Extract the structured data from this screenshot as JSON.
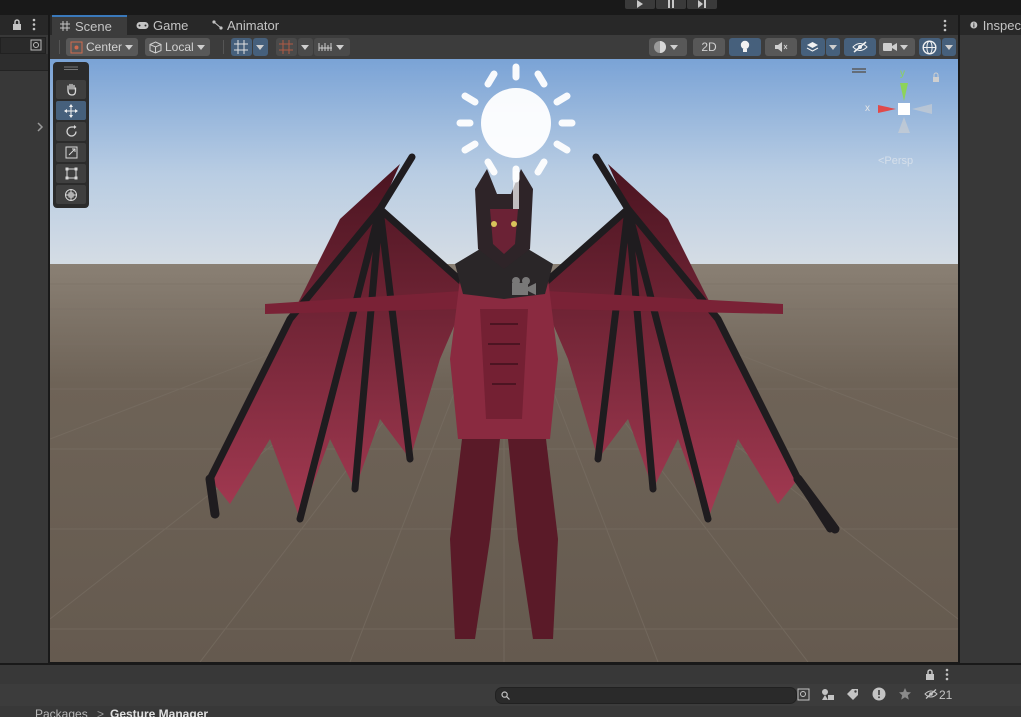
{
  "tabs": [
    {
      "label": "Scene",
      "icon": "grid-icon",
      "active": true
    },
    {
      "label": "Game",
      "icon": "gamepad-icon",
      "active": false
    },
    {
      "label": "Animator",
      "icon": "animator-icon",
      "active": false
    }
  ],
  "inspector_tab": "Inspec",
  "toolbar": {
    "pivot_label": "Center",
    "space_label": "Local",
    "mode_2d_label": "2D"
  },
  "gizmo": {
    "y_label": "y",
    "x_label": "x",
    "persp_label": "<Persp"
  },
  "bottom": {
    "breadcrumb_root": "Packages",
    "breadcrumb_sep": ">",
    "breadcrumb_current": "Gesture Manager",
    "hidden_count": "21"
  },
  "colors": {
    "accent": "#3a79bb",
    "selected_button": "#46607c",
    "panel_bg": "#383838",
    "toolbar_bg": "#3c3c3c",
    "sky_top": "#7aa3d6",
    "ground": "#6a5e52"
  }
}
